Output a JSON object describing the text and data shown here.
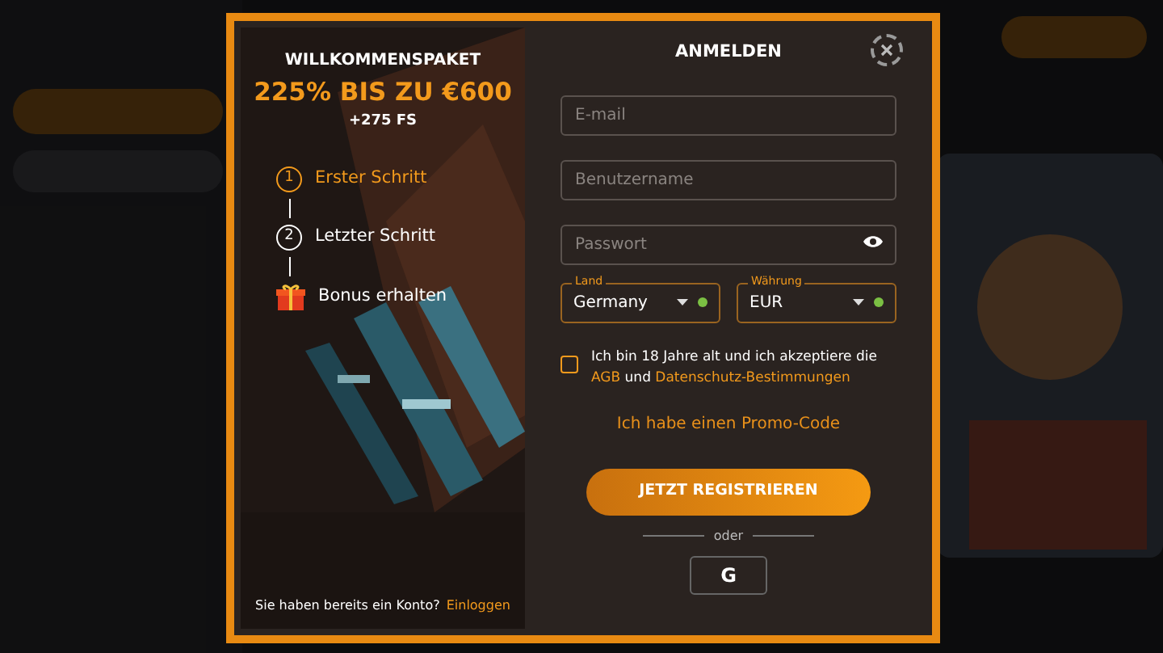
{
  "promo": {
    "heading": "WILLKOMMENSPAKET",
    "offer": "225% BIS ZU €600",
    "extra": "+275 FS",
    "steps": [
      {
        "kind": "number",
        "number": "1",
        "label": "Erster Schritt",
        "selected": true
      },
      {
        "kind": "number",
        "number": "2",
        "label": "Letzter Schritt",
        "selected": false
      },
      {
        "kind": "gift",
        "label": "Bonus erhalten",
        "selected": false
      }
    ],
    "login_prompt": "Sie haben bereits ein Konto?",
    "login_link": "Einloggen"
  },
  "form": {
    "title": "ANMELDEN",
    "fields": [
      {
        "kind": "text",
        "placeholder": "E-mail"
      },
      {
        "kind": "text",
        "placeholder": "Benutzername"
      },
      {
        "kind": "password",
        "placeholder": "Passwort"
      }
    ],
    "selects": [
      {
        "label": "Land",
        "value": "Germany",
        "valid": true
      },
      {
        "label": "Währung",
        "value": "EUR",
        "valid": true
      }
    ],
    "agreement": {
      "checked": false,
      "text_1": "Ich bin 18 Jahre alt und ich akzeptiere die",
      "link_1": "AGB",
      "text_2": "und",
      "link_2": "Datenschutz-Bestimmungen"
    },
    "promo_code_link": "Ich habe einen Promo-Code",
    "submit": "JETZT REGISTRIEREN",
    "divider": "oder",
    "social": "G"
  }
}
